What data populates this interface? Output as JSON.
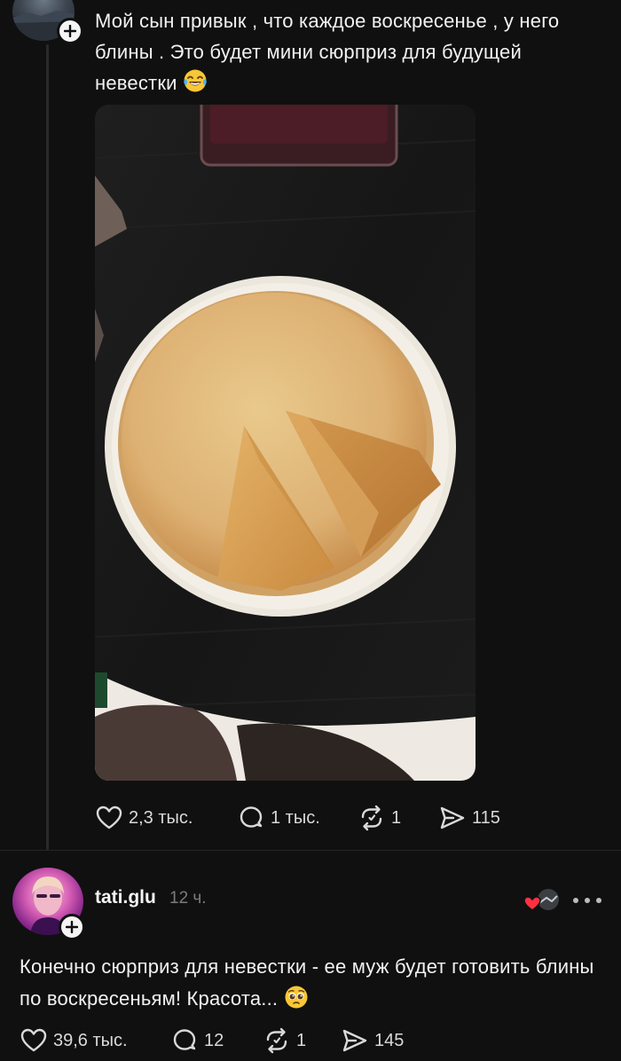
{
  "post": {
    "text": "Мой сын привык , что каждое воскресенье , у него блины . Это будет мини сюрприз для будущей невестки",
    "text_emoji": "face-with-tears-of-joy-icon",
    "photo": "pancakes-on-plate-photo",
    "actions": {
      "likes": "2,3 тыс.",
      "comments": "1 тыс.",
      "reposts": "1",
      "shares": "115"
    }
  },
  "reply": {
    "username": "tati.glu",
    "time": "12 ч.",
    "text": "Конечно сюрприз для невестки - ее муж  будет готовить блины по воскресеньям! Красота...",
    "text_emoji": "pleading-face-icon",
    "actions": {
      "likes": "39,6 тыс.",
      "comments": "12",
      "reposts": "1",
      "shares": "145"
    }
  },
  "colors": {
    "background": "#101010",
    "text": "#f2f2f2",
    "muted": "#7b7b7b",
    "like_red": "#ff3040"
  }
}
